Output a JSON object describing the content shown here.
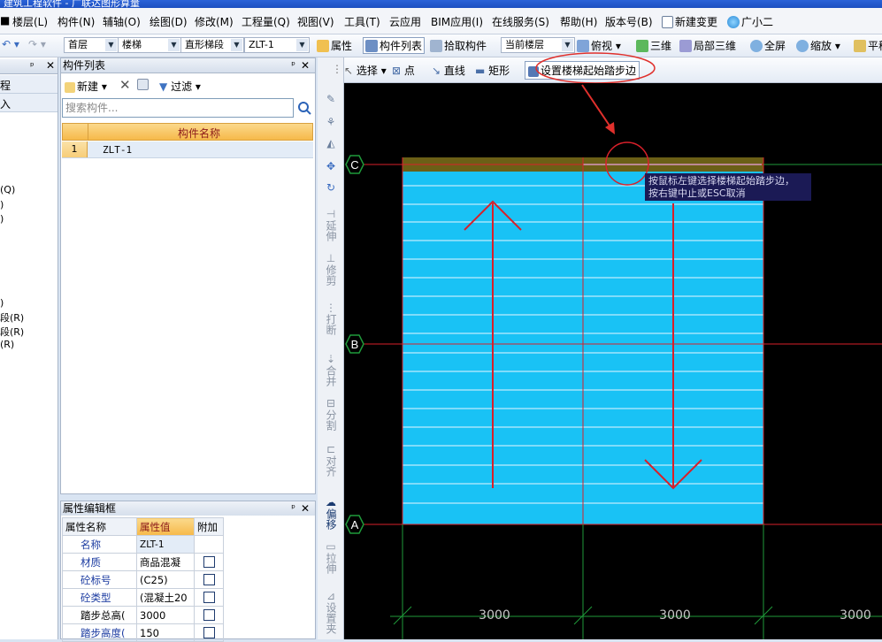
{
  "title": "建筑工程软件 - 广联达图形算量",
  "menu": [
    "楼层(L)",
    "构件(N)",
    "辅轴(O)",
    "绘图(D)",
    "修改(M)",
    "工程量(Q)",
    "视图(V)",
    "工具(T)",
    "云应用",
    "BIM应用(I)",
    "在线服务(S)",
    "帮助(H)",
    "版本号(B)",
    "新建变更",
    "广小二"
  ],
  "toolbar": {
    "floor": "首层",
    "category": "楼梯",
    "subtype": "直形梯段",
    "component": "ZLT-1",
    "attribute": "属性",
    "component_list": "构件列表",
    "pick": "拾取构件",
    "current_floor": "当前楼层",
    "view": "俯视",
    "three_d": "三维",
    "local_3d": "局部三维",
    "fullscreen": "全屏",
    "zoom": "缩放",
    "pan": "平移"
  },
  "left_strip": {
    "items": [
      "程",
      "入",
      "(Q)",
      ")",
      ")",
      ")",
      "段(R)",
      "段(R)",
      "(R)"
    ]
  },
  "component_list": {
    "title": "构件列表",
    "new": "新建",
    "filter": "过滤",
    "search_placeholder": "搜索构件...",
    "column": "构件名称",
    "rows": [
      {
        "index": "1",
        "name": "ZLT-1"
      }
    ]
  },
  "property_editor": {
    "title": "属性编辑框",
    "headers": [
      "属性名称",
      "属性值",
      "附加"
    ],
    "rows": [
      {
        "name": "名称",
        "value": "ZLT-1",
        "checkbox": false
      },
      {
        "name": "材质",
        "value": "商品混凝",
        "checkbox": true
      },
      {
        "name": "砼标号",
        "value": "(C25)",
        "checkbox": true
      },
      {
        "name": "砼类型",
        "value": "(混凝土20",
        "checkbox": true
      },
      {
        "name": "踏步总高(",
        "value": "3000",
        "checkbox": true
      },
      {
        "name": "踏步高度(",
        "value": "150",
        "checkbox": true
      }
    ]
  },
  "draw_toolbar": {
    "select": "选择",
    "point": "点",
    "line": "直线",
    "rect": "矩形",
    "set_start": "设置楼梯起始踏步边"
  },
  "vertical_tools": [
    "延伸",
    "修剪",
    "打断",
    "合并",
    "分割",
    "对齐",
    "偏移",
    "拉伸",
    "设置夹"
  ],
  "canvas": {
    "axes": [
      "C",
      "B",
      "A"
    ],
    "dimensions": [
      "3000",
      "3000",
      "3000"
    ],
    "tooltip_line1": "按鼠标左键选择楼梯起始踏步边，",
    "tooltip_line2": "按右键中止或ESC取消"
  },
  "colors": {
    "stair_fill": "#19c2f5",
    "axis_red": "#d8202a",
    "axis_green": "#1f9a3a",
    "highlight": "#f0a030"
  }
}
